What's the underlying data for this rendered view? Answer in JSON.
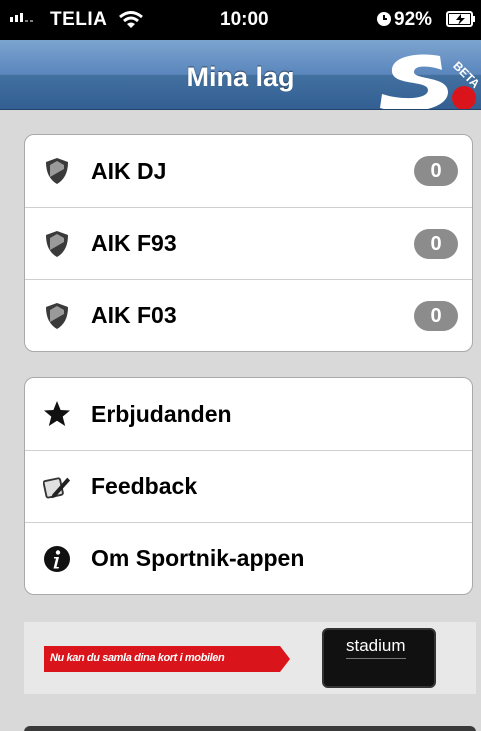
{
  "status_bar": {
    "carrier": "TELIA",
    "time": "10:00",
    "battery_percent": "92%"
  },
  "nav": {
    "title": "Mina lag",
    "logo_badge": "BETA"
  },
  "teams": [
    {
      "name": "AIK DJ",
      "count": "0",
      "icon": "shield-icon"
    },
    {
      "name": "AIK F93",
      "count": "0",
      "icon": "shield-icon"
    },
    {
      "name": "AIK F03",
      "count": "0",
      "icon": "shield-icon"
    }
  ],
  "menu": [
    {
      "label": "Erbjudanden",
      "icon": "star-icon"
    },
    {
      "label": "Feedback",
      "icon": "feedback-icon"
    },
    {
      "label": "Om Sportnik-appen",
      "icon": "info-icon"
    }
  ],
  "ad": {
    "text": "Nu kan du samla dina kort i mobilen",
    "brand": "stadium",
    "accent": "#d9151b"
  }
}
